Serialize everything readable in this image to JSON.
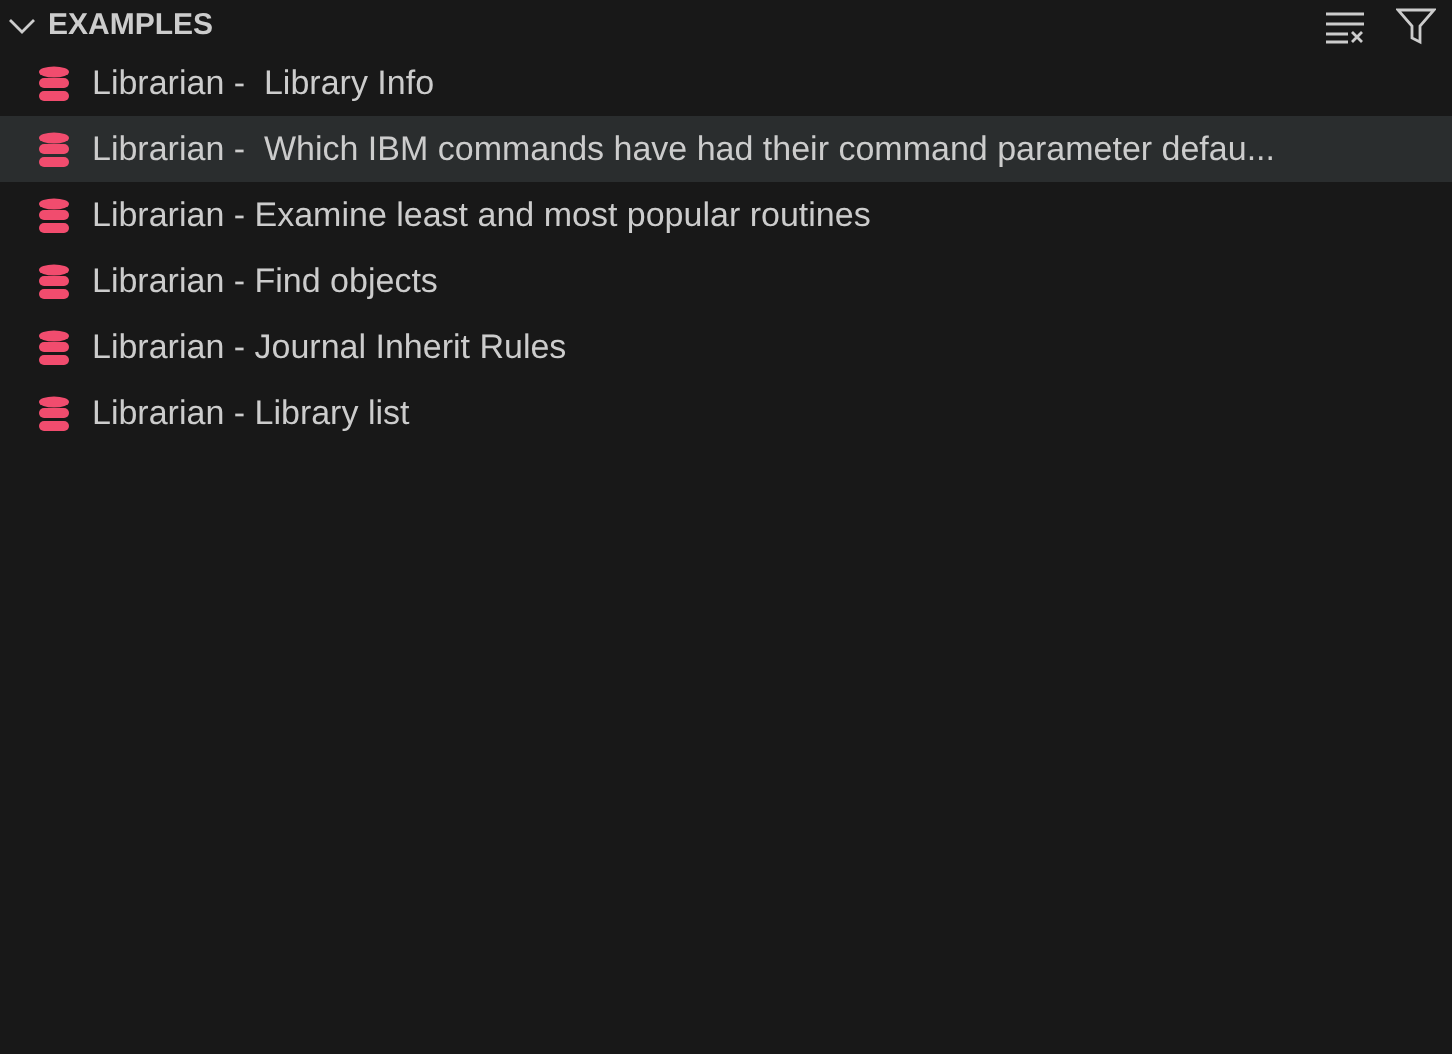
{
  "section": {
    "title": "EXAMPLES",
    "expanded": true
  },
  "items": [
    {
      "label": "Librarian -  Library Info",
      "selected": false
    },
    {
      "label": "Librarian -  Which IBM commands have had their command parameter defau...",
      "selected": true
    },
    {
      "label": "Librarian - Examine least and most popular routines",
      "selected": false
    },
    {
      "label": "Librarian - Find objects",
      "selected": false
    },
    {
      "label": "Librarian - Journal Inherit Rules",
      "selected": false
    },
    {
      "label": "Librarian - Library list",
      "selected": false
    }
  ]
}
